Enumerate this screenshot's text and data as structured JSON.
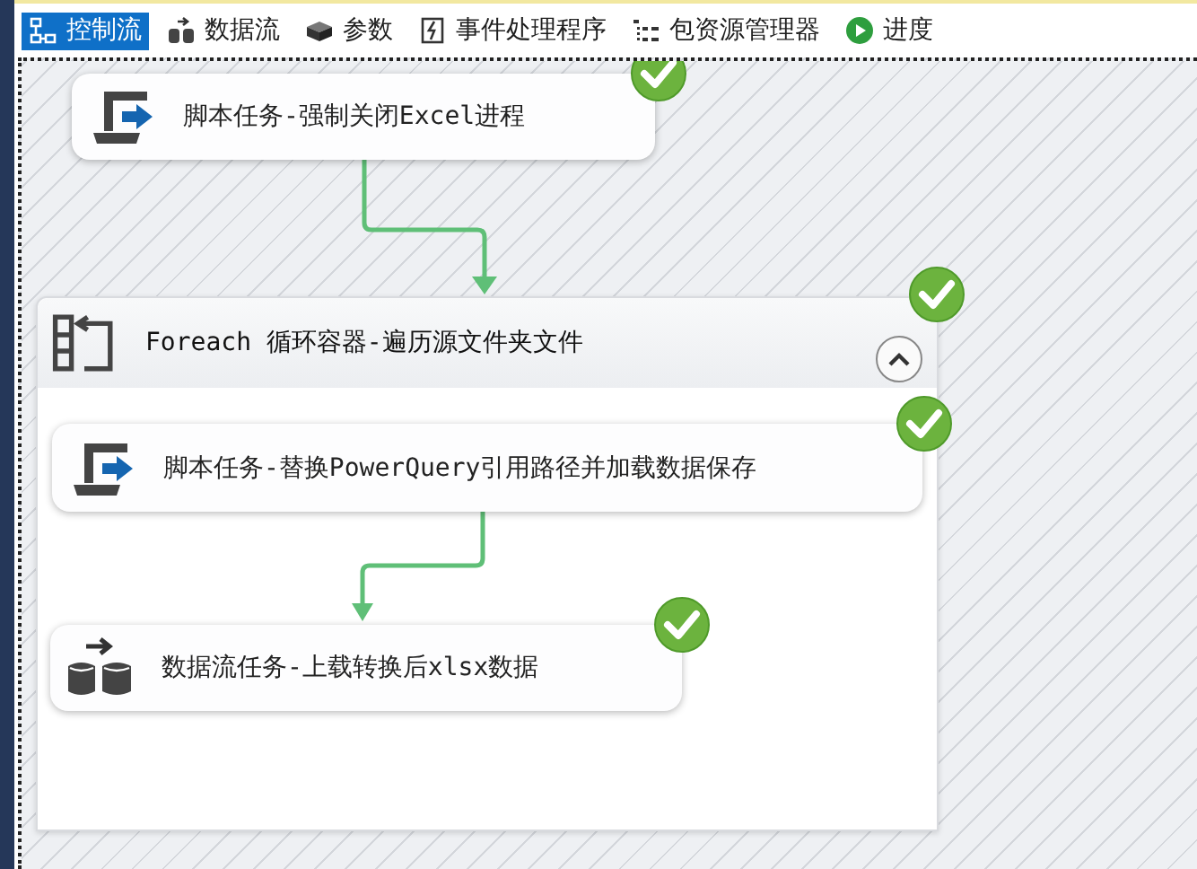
{
  "tabs": [
    {
      "label": "控制流",
      "kind": "flow",
      "selected": true
    },
    {
      "label": "数据流",
      "kind": "dataflow",
      "selected": false
    },
    {
      "label": "参数",
      "kind": "cube",
      "selected": false
    },
    {
      "label": "事件处理程序",
      "kind": "event",
      "selected": false
    },
    {
      "label": "包资源管理器",
      "kind": "tree",
      "selected": false
    },
    {
      "label": "进度",
      "kind": "play",
      "selected": false
    }
  ],
  "task": {
    "kind": "script",
    "label": "脚本任务-强制关闭Excel进程",
    "success": true
  },
  "container": {
    "label": "Foreach 循环容器-遍历源文件夹文件",
    "success": true,
    "expanded": true,
    "tasks": [
      {
        "kind": "script",
        "label": "脚本任务-替换PowerQuery引用路径并加载数据保存",
        "success": true
      },
      {
        "kind": "dataflow",
        "label": "数据流任务-上载转换后xlsx数据",
        "success": true
      }
    ]
  }
}
